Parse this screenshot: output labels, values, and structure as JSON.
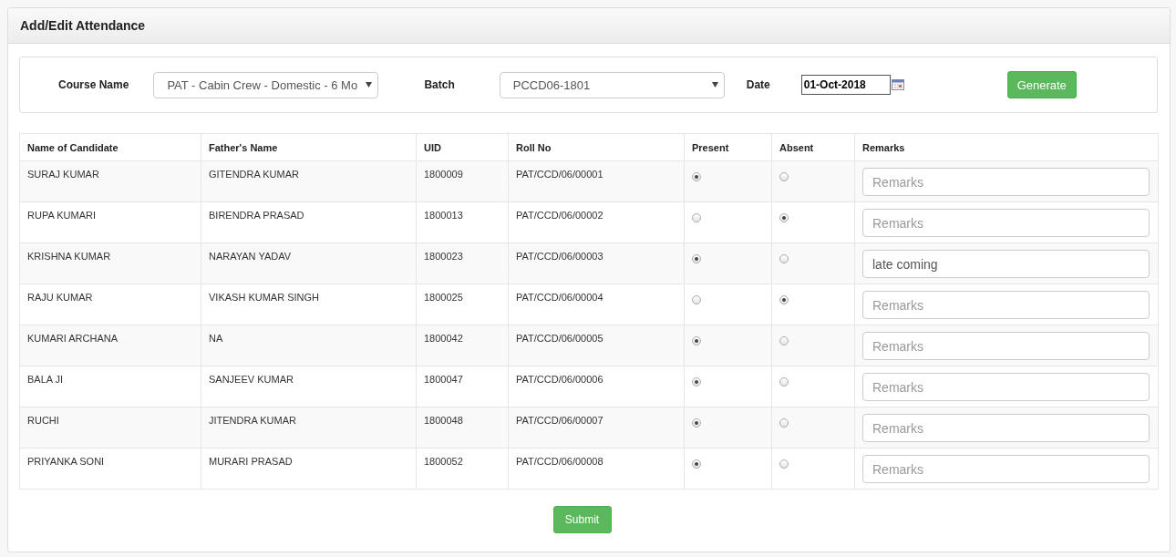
{
  "panel": {
    "title": "Add/Edit Attendance"
  },
  "filters": {
    "course": {
      "label": "Course Name",
      "value": "PAT - Cabin Crew - Domestic - 6 Mo"
    },
    "batch": {
      "label": "Batch",
      "value": "PCCD06-1801"
    },
    "date": {
      "label": "Date",
      "value": "01-Oct-2018"
    },
    "generate_button": "Generate"
  },
  "table": {
    "columns": [
      "Name of Candidate",
      "Father's Name",
      "UID",
      "Roll No",
      "Present",
      "Absent",
      "Remarks"
    ],
    "rows": [
      {
        "name": "SURAJ KUMAR",
        "father": "GITENDRA KUMAR",
        "uid": "1800009",
        "roll": "PAT/CCD/06/00001",
        "present": {
          "selected": true
        },
        "absent": {
          "selected": false
        },
        "remarks": {
          "placeholder": "Remarks"
        }
      },
      {
        "name": "RUPA KUMARI",
        "father": "BIRENDRA PRASAD",
        "uid": "1800013",
        "roll": "PAT/CCD/06/00002",
        "present": {
          "selected": false
        },
        "absent": {
          "selected": true
        },
        "remarks": {
          "placeholder": "Remarks"
        }
      },
      {
        "name": "KRISHNA KUMAR",
        "father": "NARAYAN YADAV",
        "uid": "1800023",
        "roll": "PAT/CCD/06/00003",
        "present": {
          "selected": true
        },
        "absent": {
          "selected": false
        },
        "remarks": {
          "value": "late coming"
        }
      },
      {
        "name": "RAJU KUMAR",
        "father": "VIKASH KUMAR SINGH",
        "uid": "1800025",
        "roll": "PAT/CCD/06/00004",
        "present": {
          "selected": false
        },
        "absent": {
          "selected": true
        },
        "remarks": {
          "placeholder": "Remarks"
        }
      },
      {
        "name": "KUMARI ARCHANA",
        "father": "NA",
        "uid": "1800042",
        "roll": "PAT/CCD/06/00005",
        "present": {
          "selected": true
        },
        "absent": {
          "selected": false
        },
        "remarks": {
          "placeholder": "Remarks"
        }
      },
      {
        "name": "BALA JI",
        "father": "SANJEEV KUMAR",
        "uid": "1800047",
        "roll": "PAT/CCD/06/00006",
        "present": {
          "selected": true
        },
        "absent": {
          "selected": false
        },
        "remarks": {
          "placeholder": "Remarks"
        }
      },
      {
        "name": "RUCHI",
        "father": "JITENDRA KUMAR",
        "uid": "1800048",
        "roll": "PAT/CCD/06/00007",
        "present": {
          "selected": true
        },
        "absent": {
          "selected": false
        },
        "remarks": {
          "placeholder": "Remarks"
        }
      },
      {
        "name": "PRIYANKA SONI",
        "father": "MURARI PRASAD",
        "uid": "1800052",
        "roll": "PAT/CCD/06/00008",
        "present": {
          "selected": true
        },
        "absent": {
          "selected": false
        },
        "remarks": {
          "placeholder": "Remarks"
        }
      }
    ]
  },
  "submit_button": "Submit"
}
